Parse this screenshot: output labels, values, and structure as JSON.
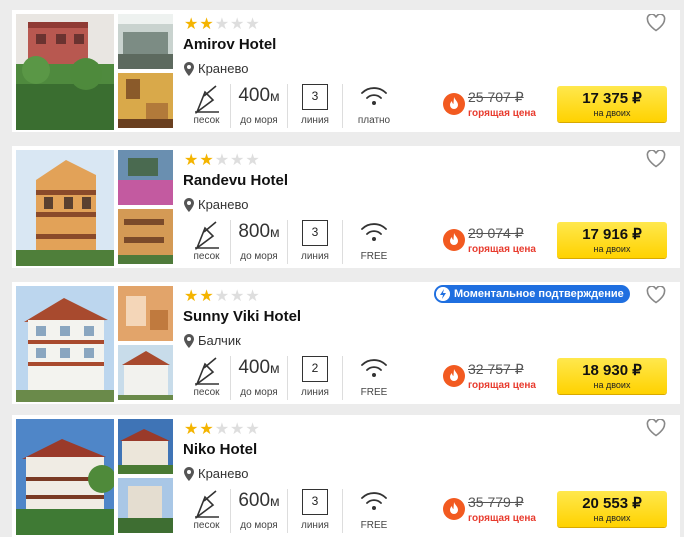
{
  "rating_max": 5,
  "colors": {
    "accent": "#ffd200",
    "hot": "#e83b2e",
    "fire": "#f25a20",
    "star": "#f4b400",
    "badge": "#1f6fe0"
  },
  "icons": {
    "rating": "star-icon",
    "location": "map-pin-icon",
    "beach": "sand-shovel-icon",
    "wifi": "wifi-icon",
    "hot": "fire-icon",
    "favorite": "heart-outline-icon",
    "badge": "lightning-icon"
  },
  "hotels": [
    {
      "rating": 2,
      "name": "Amirov Hotel",
      "location": "Кранево",
      "beach_label": "песок",
      "distance_value": "400",
      "distance_unit": "м",
      "distance_label": "до моря",
      "line_value": "3",
      "line_label": "линия",
      "wifi_label": "платно",
      "old_price": "25 707 ₽",
      "hot_label": "горящая цена",
      "price": "17 375 ₽",
      "price_note": "на двоих",
      "badge": null
    },
    {
      "rating": 2,
      "name": "Randevu Hotel",
      "location": "Кранево",
      "beach_label": "песок",
      "distance_value": "800",
      "distance_unit": "м",
      "distance_label": "до моря",
      "line_value": "3",
      "line_label": "линия",
      "wifi_label": "FREE",
      "old_price": "29 074 ₽",
      "hot_label": "горящая цена",
      "price": "17 916 ₽",
      "price_note": "на двоих",
      "badge": null
    },
    {
      "rating": 2,
      "name": "Sunny Viki Hotel",
      "location": "Балчик",
      "beach_label": "песок",
      "distance_value": "400",
      "distance_unit": "м",
      "distance_label": "до моря",
      "line_value": "2",
      "line_label": "линия",
      "wifi_label": "FREE",
      "old_price": "32 757 ₽",
      "hot_label": "горящая цена",
      "price": "18 930 ₽",
      "price_note": "на двоих",
      "badge": "Моментальное подтверждение"
    },
    {
      "rating": 2,
      "name": "Niko Hotel",
      "location": "Кранево",
      "beach_label": "песок",
      "distance_value": "600",
      "distance_unit": "м",
      "distance_label": "до моря",
      "line_value": "3",
      "line_label": "линия",
      "wifi_label": "FREE",
      "old_price": "35 779 ₽",
      "hot_label": "горящая цена",
      "price": "20 553 ₽",
      "price_note": "на двоих",
      "badge": null
    }
  ]
}
